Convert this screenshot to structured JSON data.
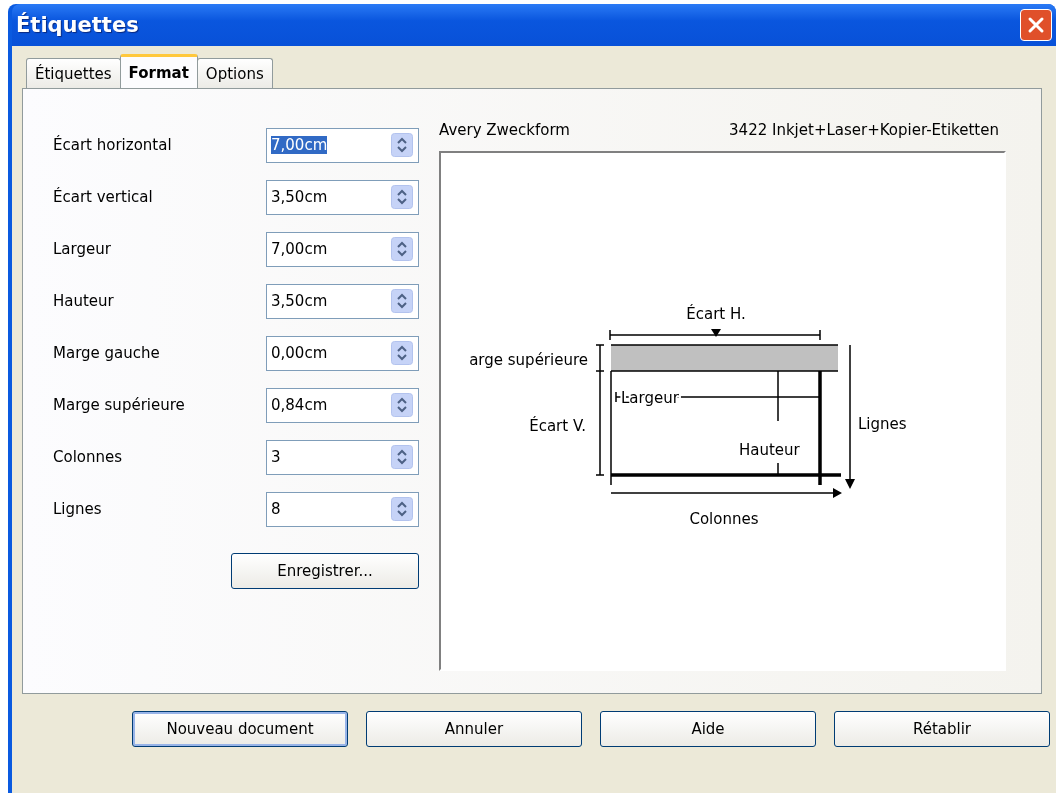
{
  "window": {
    "title": "Étiquettes"
  },
  "tabs": [
    {
      "label": "Étiquettes",
      "selected": false
    },
    {
      "label": "Format",
      "selected": true
    },
    {
      "label": "Options",
      "selected": false
    }
  ],
  "fields": [
    {
      "label": "Écart horizontal",
      "value": "7,00cm",
      "selected": true
    },
    {
      "label": "Écart vertical",
      "value": "3,50cm",
      "selected": false
    },
    {
      "label": "Largeur",
      "value": "7,00cm",
      "selected": false
    },
    {
      "label": "Hauteur",
      "value": "3,50cm",
      "selected": false
    },
    {
      "label": "Marge gauche",
      "value": "0,00cm",
      "selected": false
    },
    {
      "label": "Marge supérieure",
      "value": "0,84cm",
      "selected": false
    },
    {
      "label": "Colonnes",
      "value": "3",
      "selected": false
    },
    {
      "label": "Lignes",
      "value": "8",
      "selected": false
    }
  ],
  "save_button": "Enregistrer...",
  "preview": {
    "brand": "Avery Zweckform",
    "product": "3422 Inkjet+Laser+Kopier-Etiketten",
    "diagram": {
      "gap_h": "Écart H.",
      "top_margin": "arge supérieure",
      "gap_v": "Écart V.",
      "width": "Largeur",
      "height": "Hauteur",
      "rows": "Lignes",
      "columns": "Colonnes"
    }
  },
  "buttons": [
    {
      "label": "Nouveau document",
      "default": true
    },
    {
      "label": "Annuler",
      "default": false
    },
    {
      "label": "Aide",
      "default": false
    },
    {
      "label": "Rétablir",
      "default": false
    }
  ]
}
